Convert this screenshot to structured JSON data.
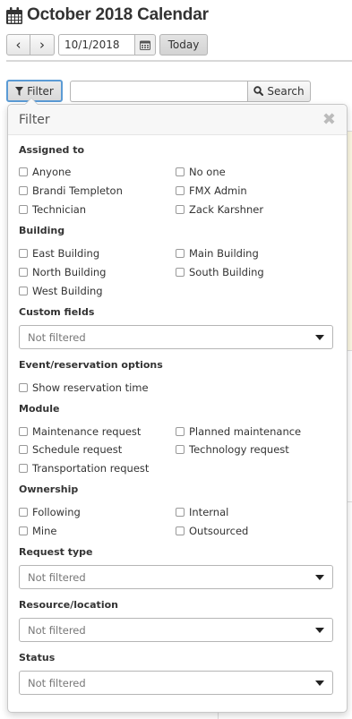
{
  "page": {
    "title": "October 2018 Calendar"
  },
  "nav": {
    "prev_label": "‹",
    "next_label": "›",
    "date_value": "10/1/2018",
    "today_label": "Today"
  },
  "toolbar": {
    "filter_label": "Filter",
    "search_value": "",
    "search_label": "Search"
  },
  "filter_panel": {
    "title": "Filter",
    "close": "✖",
    "sections": {
      "assigned_to": {
        "label": "Assigned to",
        "options": [
          "Anyone",
          "No one",
          "Brandi Templeton",
          "FMX Admin",
          "Technician",
          "Zack Karshner"
        ]
      },
      "building": {
        "label": "Building",
        "options": [
          "East Building",
          "Main Building",
          "North Building",
          "South Building",
          "West Building"
        ]
      },
      "custom_fields": {
        "label": "Custom fields",
        "value": "Not filtered"
      },
      "event_options": {
        "label": "Event/reservation options",
        "options": [
          "Show reservation time"
        ]
      },
      "module": {
        "label": "Module",
        "options": [
          "Maintenance request",
          "Planned maintenance",
          "Schedule request",
          "Technology request",
          "Transportation request"
        ]
      },
      "ownership": {
        "label": "Ownership",
        "options": [
          "Following",
          "Internal",
          "Mine",
          "Outsourced"
        ]
      },
      "request_type": {
        "label": "Request type",
        "value": "Not filtered"
      },
      "resource_location": {
        "label": "Resource/location",
        "value": "Not filtered"
      },
      "status": {
        "label": "Status",
        "value": "Not filtered"
      }
    }
  },
  "colors": {
    "focus_border": "#5b9bd5",
    "highlight_bg": "#fcf8e3"
  },
  "icons": [
    "calendar-icon",
    "chevron-left-icon",
    "chevron-right-icon",
    "calendar-picker-icon",
    "filter-icon",
    "search-icon",
    "close-icon",
    "caret-down-icon"
  ]
}
